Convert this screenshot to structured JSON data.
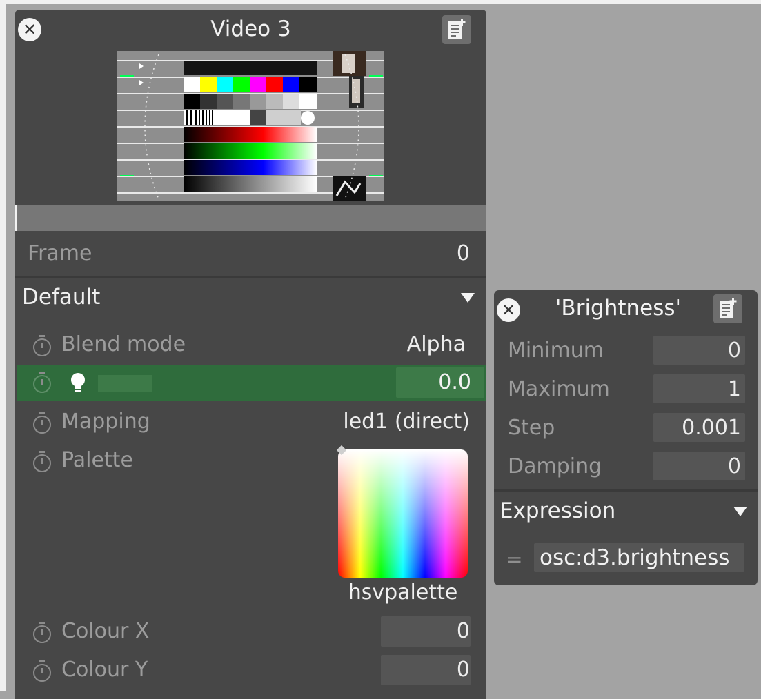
{
  "video_panel": {
    "title": "Video 3",
    "frame": {
      "label": "Frame",
      "value": "0"
    },
    "section": {
      "title": "Default"
    },
    "params": {
      "blend_mode": {
        "label": "Blend mode",
        "value": "Alpha"
      },
      "brightness": {
        "value": "0.0"
      },
      "mapping": {
        "label": "Mapping",
        "value": "led1 (direct)"
      },
      "palette": {
        "label": "Palette",
        "value": "hsvpalette"
      },
      "colour_x": {
        "label": "Colour X",
        "value": "0"
      },
      "colour_y": {
        "label": "Colour Y",
        "value": "0"
      }
    }
  },
  "brightness_popup": {
    "title": "'Brightness'",
    "minimum": {
      "label": "Minimum",
      "value": "0"
    },
    "maximum": {
      "label": "Maximum",
      "value": "1"
    },
    "step": {
      "label": "Step",
      "value": "0.001"
    },
    "damping": {
      "label": "Damping",
      "value": "0"
    },
    "expression": {
      "title": "Expression",
      "prefix": "=",
      "value": "osc:d3.brightness"
    }
  },
  "icons": [
    "close-icon",
    "notes-icon",
    "clock-icon",
    "bulb-icon",
    "triangle-down-icon"
  ],
  "colors": {
    "background": "#a3a3a3",
    "panel": "#474747",
    "selected_row": "#2f6c3c",
    "field": "#555555"
  }
}
